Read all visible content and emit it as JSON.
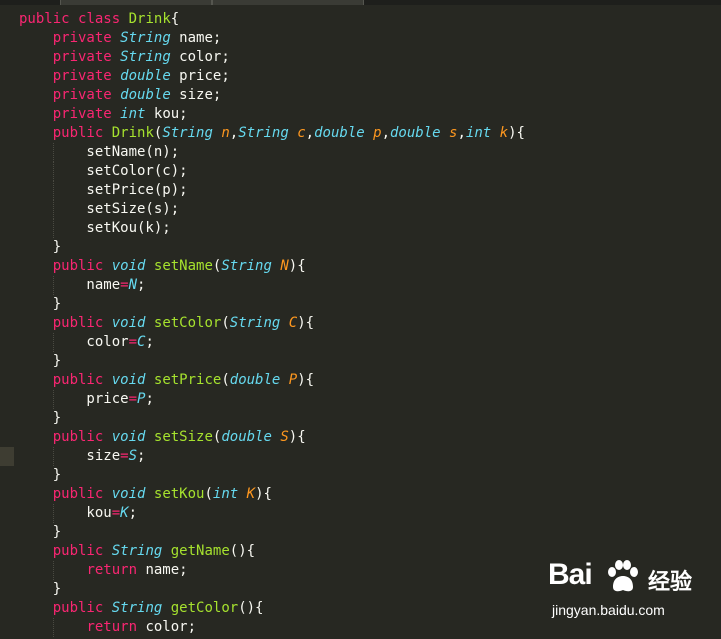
{
  "editor": {
    "lines": [
      [
        [
          "kw",
          "public"
        ],
        [
          "plain",
          " "
        ],
        [
          "kw",
          "class"
        ],
        [
          "plain",
          " "
        ],
        [
          "name",
          "Drink"
        ],
        [
          "plain",
          "{"
        ]
      ],
      [
        [
          "plain",
          "    "
        ],
        [
          "kw",
          "private"
        ],
        [
          "plain",
          " "
        ],
        [
          "type",
          "String"
        ],
        [
          "plain",
          " name;"
        ]
      ],
      [
        [
          "plain",
          "    "
        ],
        [
          "kw",
          "private"
        ],
        [
          "plain",
          " "
        ],
        [
          "type",
          "String"
        ],
        [
          "plain",
          " color;"
        ]
      ],
      [
        [
          "plain",
          "    "
        ],
        [
          "kw",
          "private"
        ],
        [
          "plain",
          " "
        ],
        [
          "type",
          "double"
        ],
        [
          "plain",
          " price;"
        ]
      ],
      [
        [
          "plain",
          "    "
        ],
        [
          "kw",
          "private"
        ],
        [
          "plain",
          " "
        ],
        [
          "type",
          "double"
        ],
        [
          "plain",
          " size;"
        ]
      ],
      [
        [
          "plain",
          "    "
        ],
        [
          "kw",
          "private"
        ],
        [
          "plain",
          " "
        ],
        [
          "type",
          "int"
        ],
        [
          "plain",
          " kou;"
        ]
      ],
      [
        [
          "plain",
          "    "
        ],
        [
          "kw",
          "public"
        ],
        [
          "plain",
          " "
        ],
        [
          "name",
          "Drink"
        ],
        [
          "plain",
          "("
        ],
        [
          "type",
          "String"
        ],
        [
          "plain",
          " "
        ],
        [
          "param",
          "n"
        ],
        [
          "plain",
          ","
        ],
        [
          "type",
          "String"
        ],
        [
          "plain",
          " "
        ],
        [
          "param",
          "c"
        ],
        [
          "plain",
          ","
        ],
        [
          "type",
          "double"
        ],
        [
          "plain",
          " "
        ],
        [
          "param",
          "p"
        ],
        [
          "plain",
          ","
        ],
        [
          "type",
          "double"
        ],
        [
          "plain",
          " "
        ],
        [
          "param",
          "s"
        ],
        [
          "plain",
          ","
        ],
        [
          "type",
          "int"
        ],
        [
          "plain",
          " "
        ],
        [
          "param",
          "k"
        ],
        [
          "plain",
          "){"
        ]
      ],
      [
        [
          "plain",
          "        setName(n);"
        ]
      ],
      [
        [
          "plain",
          "        setColor(c);"
        ]
      ],
      [
        [
          "plain",
          "        setPrice(p);"
        ]
      ],
      [
        [
          "plain",
          "        setSize(s);"
        ]
      ],
      [
        [
          "plain",
          "        setKou(k);"
        ]
      ],
      [
        [
          "plain",
          "    }"
        ]
      ],
      [
        [
          "plain",
          "    "
        ],
        [
          "kw",
          "public"
        ],
        [
          "plain",
          " "
        ],
        [
          "type",
          "void"
        ],
        [
          "plain",
          " "
        ],
        [
          "name",
          "setName"
        ],
        [
          "plain",
          "("
        ],
        [
          "type",
          "String"
        ],
        [
          "plain",
          " "
        ],
        [
          "param",
          "N"
        ],
        [
          "plain",
          "){"
        ]
      ],
      [
        [
          "plain",
          "        name"
        ],
        [
          "op",
          "="
        ],
        [
          "type",
          "N"
        ],
        [
          "plain",
          ";"
        ]
      ],
      [
        [
          "plain",
          "    }"
        ]
      ],
      [
        [
          "plain",
          "    "
        ],
        [
          "kw",
          "public"
        ],
        [
          "plain",
          " "
        ],
        [
          "type",
          "void"
        ],
        [
          "plain",
          " "
        ],
        [
          "name",
          "setColor"
        ],
        [
          "plain",
          "("
        ],
        [
          "type",
          "String"
        ],
        [
          "plain",
          " "
        ],
        [
          "param",
          "C"
        ],
        [
          "plain",
          "){"
        ]
      ],
      [
        [
          "plain",
          "        color"
        ],
        [
          "op",
          "="
        ],
        [
          "type",
          "C"
        ],
        [
          "plain",
          ";"
        ]
      ],
      [
        [
          "plain",
          "    }"
        ]
      ],
      [
        [
          "plain",
          "    "
        ],
        [
          "kw",
          "public"
        ],
        [
          "plain",
          " "
        ],
        [
          "type",
          "void"
        ],
        [
          "plain",
          " "
        ],
        [
          "name",
          "setPrice"
        ],
        [
          "plain",
          "("
        ],
        [
          "type",
          "double"
        ],
        [
          "plain",
          " "
        ],
        [
          "param",
          "P"
        ],
        [
          "plain",
          "){"
        ]
      ],
      [
        [
          "plain",
          "        price"
        ],
        [
          "op",
          "="
        ],
        [
          "type",
          "P"
        ],
        [
          "plain",
          ";"
        ]
      ],
      [
        [
          "plain",
          "    }"
        ]
      ],
      [
        [
          "plain",
          "    "
        ],
        [
          "kw",
          "public"
        ],
        [
          "plain",
          " "
        ],
        [
          "type",
          "void"
        ],
        [
          "plain",
          " "
        ],
        [
          "name",
          "setSize"
        ],
        [
          "plain",
          "("
        ],
        [
          "type",
          "double"
        ],
        [
          "plain",
          " "
        ],
        [
          "param",
          "S"
        ],
        [
          "plain",
          "){"
        ]
      ],
      [
        [
          "plain",
          "        size"
        ],
        [
          "op",
          "="
        ],
        [
          "type",
          "S"
        ],
        [
          "plain",
          ";"
        ]
      ],
      [
        [
          "plain",
          "    }"
        ]
      ],
      [
        [
          "plain",
          "    "
        ],
        [
          "kw",
          "public"
        ],
        [
          "plain",
          " "
        ],
        [
          "type",
          "void"
        ],
        [
          "plain",
          " "
        ],
        [
          "name",
          "setKou"
        ],
        [
          "plain",
          "("
        ],
        [
          "type",
          "int"
        ],
        [
          "plain",
          " "
        ],
        [
          "param",
          "K"
        ],
        [
          "plain",
          "){"
        ]
      ],
      [
        [
          "plain",
          "        kou"
        ],
        [
          "op",
          "="
        ],
        [
          "type",
          "K"
        ],
        [
          "plain",
          ";"
        ]
      ],
      [
        [
          "plain",
          "    }"
        ]
      ],
      [
        [
          "plain",
          "    "
        ],
        [
          "kw",
          "public"
        ],
        [
          "plain",
          " "
        ],
        [
          "type",
          "String"
        ],
        [
          "plain",
          " "
        ],
        [
          "name",
          "getName"
        ],
        [
          "plain",
          "(){"
        ]
      ],
      [
        [
          "plain",
          "        "
        ],
        [
          "kw",
          "return"
        ],
        [
          "plain",
          " name;"
        ]
      ],
      [
        [
          "plain",
          "    }"
        ]
      ],
      [
        [
          "plain",
          "    "
        ],
        [
          "kw",
          "public"
        ],
        [
          "plain",
          " "
        ],
        [
          "type",
          "String"
        ],
        [
          "plain",
          " "
        ],
        [
          "name",
          "getColor"
        ],
        [
          "plain",
          "(){"
        ]
      ],
      [
        [
          "plain",
          "        "
        ],
        [
          "kw",
          "return"
        ],
        [
          "plain",
          " color;"
        ]
      ]
    ]
  },
  "watermark": {
    "brand": "Bai",
    "brand_cn": "经验",
    "url": "jingyan.baidu.com"
  },
  "colors": {
    "background": "#272822",
    "keyword": "#f92672",
    "type": "#66d9ef",
    "function_name": "#a6e22e",
    "parameter": "#fd971f",
    "text": "#f8f8f2"
  }
}
